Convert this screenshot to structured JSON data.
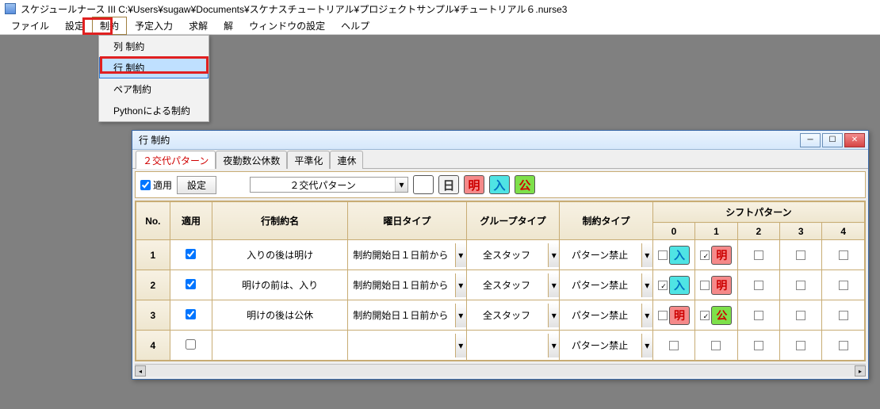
{
  "window": {
    "title": "スケジュールナース III    C:¥Users¥sugaw¥Documents¥スケナスチュートリアル¥プロジェクトサンプル¥チュートリアル６.nurse3"
  },
  "menu": {
    "file": "ファイル",
    "settings": "設定",
    "constraints": "制約",
    "schedule_input": "予定入力",
    "solve": "求解",
    "solution": "解",
    "window_settings": "ウィンドウの設定",
    "help": "ヘルプ"
  },
  "dropdown": {
    "col": "列 制約",
    "row": "行 制約",
    "pair": "ペア制約",
    "python": "Pythonによる制約"
  },
  "child": {
    "title": "行 制約",
    "tabs": {
      "t1": "２交代パターン",
      "t2": "夜勤数公休数",
      "t3": "平準化",
      "t4": "連休"
    },
    "toolbar": {
      "apply": "適用",
      "settings_btn": "設定",
      "pattern_name": "２交代パターン"
    },
    "chips": {
      "day": "日",
      "mei": "明",
      "iri": "入",
      "kou": "公"
    },
    "headers": {
      "no": "No.",
      "apply": "適用",
      "row_name": "行制約名",
      "day_type": "曜日タイプ",
      "group_type": "グループタイプ",
      "constraint_type": "制約タイプ",
      "shift_pattern": "シフトパターン",
      "c0": "0",
      "c1": "1",
      "c2": "2",
      "c3": "3",
      "c4": "4"
    },
    "rows": [
      {
        "no": "1",
        "apply": true,
        "name": "入りの後は明け",
        "day_type": "制約開始日１日前から",
        "group": "全スタッフ",
        "ctype": "パターン禁止",
        "shifts": [
          {
            "checked": false,
            "chip": "iri",
            "label": "入"
          },
          {
            "checked": true,
            "chip": "mei",
            "label": "明"
          },
          {
            "checked": false
          },
          {
            "checked": false
          },
          {
            "checked": false
          }
        ]
      },
      {
        "no": "2",
        "apply": true,
        "name": "明けの前は、入り",
        "day_type": "制約開始日１日前から",
        "group": "全スタッフ",
        "ctype": "パターン禁止",
        "shifts": [
          {
            "checked": true,
            "chip": "iri",
            "label": "入"
          },
          {
            "checked": false,
            "chip": "mei",
            "label": "明"
          },
          {
            "checked": false
          },
          {
            "checked": false
          },
          {
            "checked": false
          }
        ]
      },
      {
        "no": "3",
        "apply": true,
        "name": "明けの後は公休",
        "day_type": "制約開始日１日前から",
        "group": "全スタッフ",
        "ctype": "パターン禁止",
        "shifts": [
          {
            "checked": false,
            "chip": "mei",
            "label": "明"
          },
          {
            "checked": true,
            "chip": "kou",
            "label": "公"
          },
          {
            "checked": false
          },
          {
            "checked": false
          },
          {
            "checked": false
          }
        ]
      },
      {
        "no": "4",
        "apply": false,
        "name": "",
        "day_type": "",
        "group": "",
        "ctype": "パターン禁止",
        "shifts": [
          {
            "checked": false
          },
          {
            "checked": false
          },
          {
            "checked": false
          },
          {
            "checked": false
          },
          {
            "checked": false
          }
        ]
      }
    ]
  }
}
